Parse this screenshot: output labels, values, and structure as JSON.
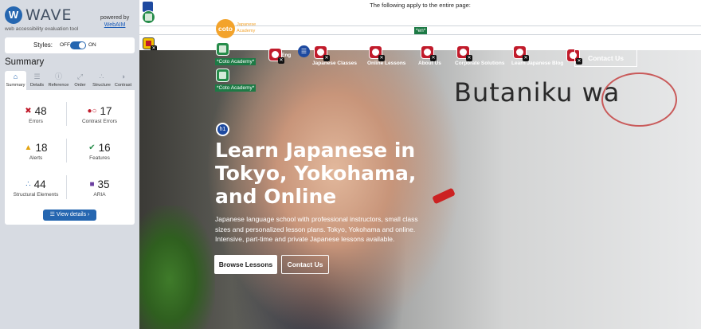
{
  "sidebar": {
    "brand_mark": "W",
    "brand_name": "WAVE",
    "brand_sub": "web accessibility evaluation tool",
    "powered_by": "powered by",
    "powered_link": "WebAIM",
    "styles": {
      "label": "Styles:",
      "off": "OFF",
      "on": "ON"
    },
    "summary_heading": "Summary",
    "tabs": [
      {
        "label": "Summary",
        "icon": "home-icon",
        "glyph": "⌂"
      },
      {
        "label": "Details",
        "icon": "list-icon",
        "glyph": "☰"
      },
      {
        "label": "Reference",
        "icon": "info-icon",
        "glyph": "ⓘ"
      },
      {
        "label": "Order",
        "icon": "order-icon",
        "glyph": "⤢"
      },
      {
        "label": "Structure",
        "icon": "structure-icon",
        "glyph": "∴"
      },
      {
        "label": "Contrast",
        "icon": "contrast-icon",
        "glyph": "◑"
      }
    ],
    "stats": [
      {
        "value": "48",
        "label": "Errors",
        "icon": "error-icon",
        "glyph": "✖",
        "color": "#c11b2b"
      },
      {
        "value": "17",
        "label": "Contrast Errors",
        "icon": "contrast-error-icon",
        "glyph": "●○",
        "color": "#c11b2b"
      },
      {
        "value": "18",
        "label": "Alerts",
        "icon": "alert-icon",
        "glyph": "▲",
        "color": "#e3a412"
      },
      {
        "value": "16",
        "label": "Features",
        "icon": "feature-icon",
        "glyph": "✔",
        "color": "#268c4a"
      },
      {
        "value": "44",
        "label": "Structural Elements",
        "icon": "structure-icon",
        "glyph": "∴",
        "color": "#2566b0"
      },
      {
        "value": "35",
        "label": "ARIA",
        "icon": "aria-icon",
        "glyph": "■",
        "color": "#6b3fa0"
      }
    ],
    "view_details": "☰  View details ›"
  },
  "page": {
    "notice": "The following apply to the entire page:",
    "lang_tag": "*en*",
    "logo_text": "coto",
    "logo_word": "Japanese\nAcademy",
    "alt_tags": [
      "*Coto Academy*",
      "*Coto Academy*"
    ],
    "nav_items": [
      "Eng",
      "Japanese Classes",
      "Online Lessons",
      "About Us",
      "Corporate Solutions",
      "Learn Japanese Blog"
    ],
    "nav_contact": "Contact Us",
    "h1_marker": "h1",
    "hero_title": "Learn Japanese in Tokyo, Yokohama, and Online",
    "hero_sub": "Japanese language school with professional instructors, small class sizes and personalized lesson plans. Tokyo, Yokohama and online. Intensive, part-time and private Japanese lessons available.",
    "btn_browse": "Browse Lessons",
    "btn_contact": "Contact Us",
    "board_text": "Butaniku  wa"
  }
}
